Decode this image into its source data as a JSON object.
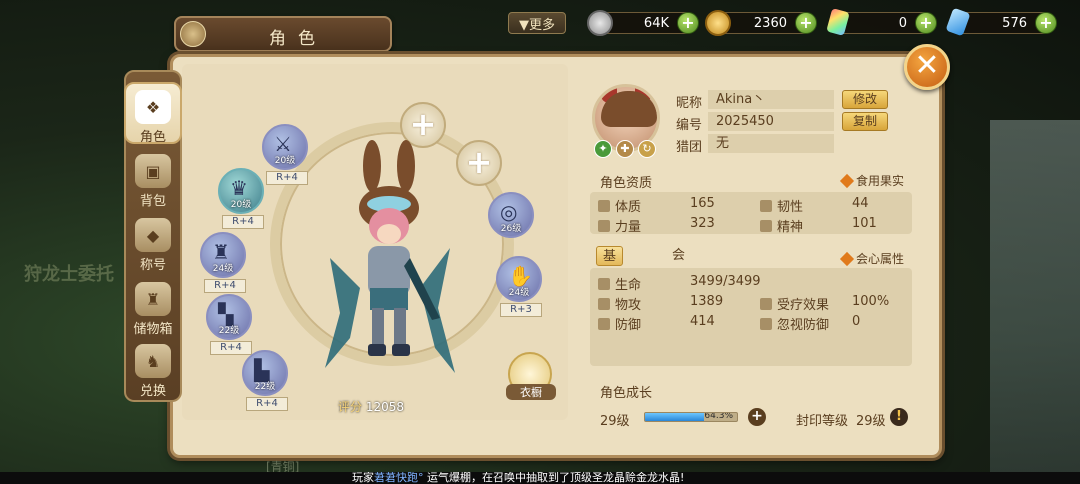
{
  "background": {
    "npc_text": "狩龙士委托"
  },
  "topbar": {
    "more_label": "▼更多",
    "currencies": [
      {
        "icon": "silver-coin-icon",
        "value": "64K"
      },
      {
        "icon": "gold-coin-icon",
        "value": "2360"
      },
      {
        "icon": "rainbow-crystal-icon",
        "value": "0"
      },
      {
        "icon": "blue-diamond-icon",
        "value": "576"
      }
    ]
  },
  "header": {
    "title": "角色"
  },
  "sidebar": {
    "items": [
      {
        "label": "角色",
        "icon": "armor-icon"
      },
      {
        "label": "背包",
        "icon": "backpack-icon"
      },
      {
        "label": "称号",
        "icon": "title-icon"
      },
      {
        "label": "储物箱",
        "icon": "storage-bag-icon"
      },
      {
        "label": "兑换",
        "icon": "exchange-bag-icon"
      }
    ],
    "active": "角色"
  },
  "equipment": {
    "slots": [
      {
        "name": "weapon",
        "level": "20级",
        "refine": "R+4"
      },
      {
        "name": "shoulder",
        "level": "20级",
        "refine": "R+4"
      },
      {
        "name": "chest",
        "level": "24级",
        "refine": "R+4"
      },
      {
        "name": "legs",
        "level": "22级",
        "refine": "R+4"
      },
      {
        "name": "boots",
        "level": "22级",
        "refine": "R+4"
      },
      {
        "name": "ring",
        "level": "26级",
        "refine": ""
      },
      {
        "name": "gloves",
        "level": "24级",
        "refine": "R+3"
      }
    ],
    "wardrobe_label": "衣橱",
    "score_label": "评分",
    "score_value": "12058"
  },
  "profile": {
    "nickname_label": "昵称",
    "nickname": "Akina丶",
    "edit_label": "修改",
    "id_label": "编号",
    "id": "2025450",
    "copy_label": "复制",
    "guild_label": "猎团",
    "guild": "无"
  },
  "aptitude": {
    "title": "角色资质",
    "link_label": "食用果实",
    "stats": [
      {
        "label": "体质",
        "value": "165"
      },
      {
        "label": "韧性",
        "value": "44"
      },
      {
        "label": "力量",
        "value": "323"
      },
      {
        "label": "精神",
        "value": "101"
      }
    ]
  },
  "attributes": {
    "tabs": [
      "基础属性",
      "会心属性"
    ],
    "active_tab": "基础属性",
    "link_label": "会心属性",
    "stats": [
      {
        "label": "生命",
        "value": "3499/3499"
      },
      {
        "label": "物攻",
        "value": "1389"
      },
      {
        "label": "受疗效果",
        "value": "100%"
      },
      {
        "label": "防御",
        "value": "414"
      },
      {
        "label": "忽视防御",
        "value": "0"
      }
    ]
  },
  "growth": {
    "title": "角色成长",
    "level": "29级",
    "progress_label": "64.3%",
    "progress_fraction": 0.643,
    "seal_label": "封印等级",
    "seal_level": "29级"
  },
  "ticker": {
    "prefix": "玩家",
    "player": "莙莙快跑°",
    "message": "运气爆棚，在召唤中抽取到了顶级圣龙晶赊金龙水晶!",
    "chat_channel": "[青铜]"
  },
  "colors": {
    "panel_bg": "#ecdfc0",
    "accent_orange": "#e07a1b",
    "progress_blue": "#2a86d8"
  }
}
